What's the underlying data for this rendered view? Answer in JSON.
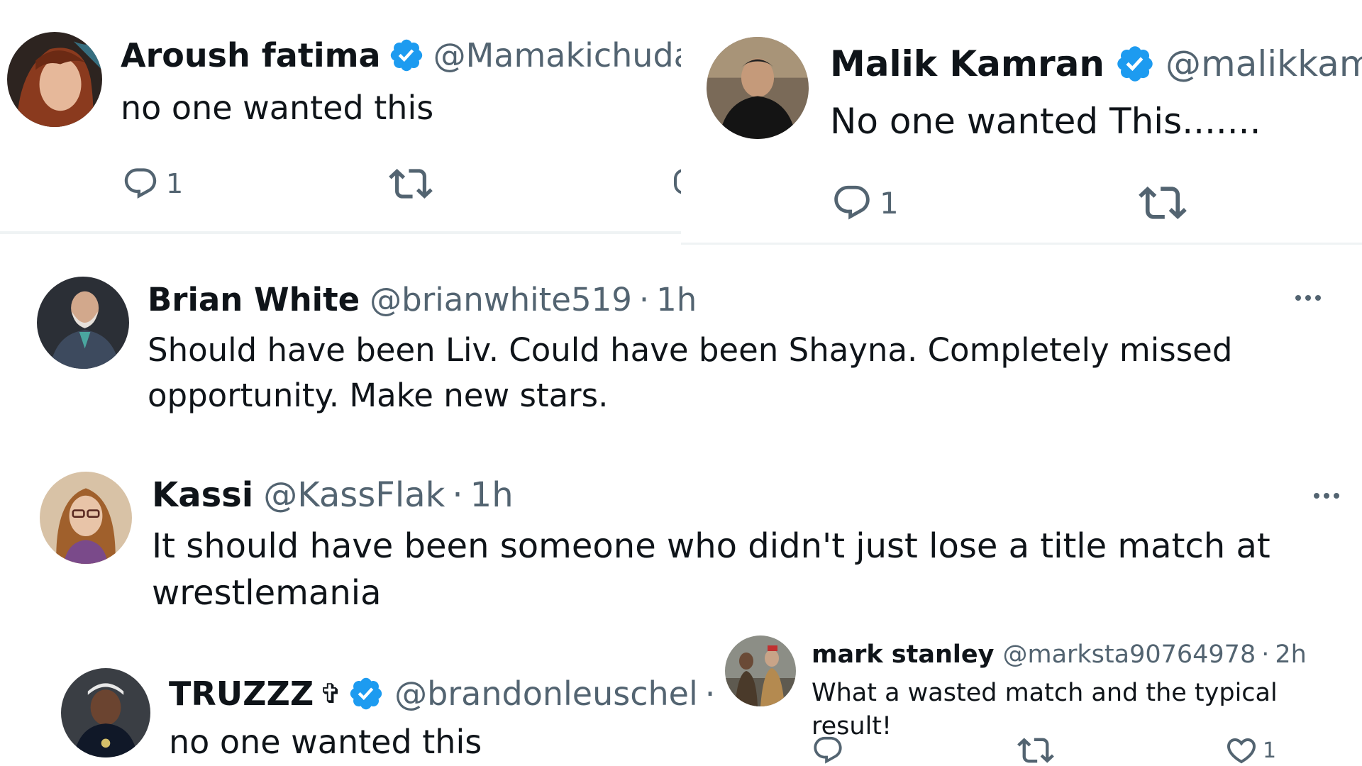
{
  "tweets": [
    {
      "name": "Aroush fatima",
      "handle": "@Mamakichuda",
      "text": "no one wanted this",
      "reply_count": "1"
    },
    {
      "name": "Malik Kamran",
      "handle": "@malikkamr",
      "text": "No one wanted This.......",
      "reply_count": "1"
    },
    {
      "name": "Brian White",
      "handle": "@brianwhite519",
      "separator": "·",
      "time": "1h",
      "text_line1": "Should have been Liv. Could have been Shayna. Completely missed",
      "text_line2": "opportunity. Make new stars."
    },
    {
      "name": "Kassi",
      "handle": "@KassFlak",
      "separator": "·",
      "time": "1h",
      "text_line1": "It should have been someone who didn't just lose a title match at",
      "text_line2": "wrestlemania"
    },
    {
      "name": "TRUZZZ",
      "cross": "✞",
      "handle": "@brandonleuschel",
      "separator": "·",
      "text": "no one wanted this"
    },
    {
      "name": "mark stanley",
      "handle": "@marksta90764978",
      "separator": "·",
      "time": "2h",
      "text": "What a wasted match and the typical result!",
      "like_count": "1"
    }
  ],
  "icons": {
    "verified": "verified-badge-icon",
    "reply": "reply-icon",
    "retweet": "retweet-icon",
    "like": "heart-icon",
    "more": "more-options-icon"
  },
  "colors": {
    "verified": "#1d9bf0",
    "text": "#0f1419",
    "secondary": "#536471",
    "divider": "#eff3f4"
  }
}
